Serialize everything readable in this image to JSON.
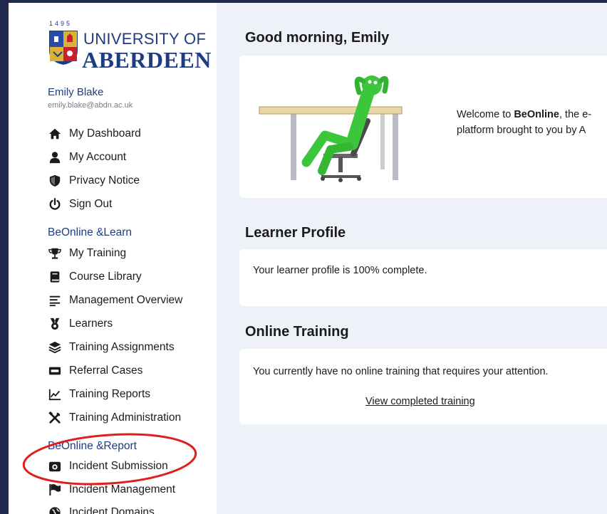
{
  "brand": {
    "year": "1495",
    "line1": "UNIVERSITY OF",
    "line2": "ABERDEEN",
    "color": "#1f3b82"
  },
  "user": {
    "name": "Emily Blake",
    "email": "emily.blake@abdn.ac.uk"
  },
  "nav_account": [
    {
      "label": "My Dashboard",
      "icon": "home-icon"
    },
    {
      "label": "My Account",
      "icon": "user-icon"
    },
    {
      "label": "Privacy Notice",
      "icon": "shield-icon"
    },
    {
      "label": "Sign Out",
      "icon": "power-icon"
    }
  ],
  "section_learn": {
    "title": "BeOnline &Learn",
    "items": [
      {
        "label": "My Training",
        "icon": "trophy-icon"
      },
      {
        "label": "Course Library",
        "icon": "book-icon"
      },
      {
        "label": "Management Overview",
        "icon": "bars-icon"
      },
      {
        "label": "Learners",
        "icon": "medal-icon"
      },
      {
        "label": "Training Assignments",
        "icon": "layers-icon"
      },
      {
        "label": "Referral Cases",
        "icon": "card-icon"
      },
      {
        "label": "Training Reports",
        "icon": "line-chart-icon"
      },
      {
        "label": "Training Administration",
        "icon": "tools-icon"
      }
    ]
  },
  "section_report": {
    "title": "BeOnline &Report",
    "items": [
      {
        "label": "Incident Submission",
        "icon": "camera-icon"
      },
      {
        "label": "Incident Management",
        "icon": "flag-icon"
      },
      {
        "label": "Incident Domains",
        "icon": "globe-icon"
      }
    ]
  },
  "main": {
    "greeting": "Good morning, Emily",
    "welcome_prefix": "Welcome to ",
    "welcome_brand": "BeOnline",
    "welcome_rest": ", the e-",
    "welcome_line2": "platform brought to you by A",
    "learner_profile_title": "Learner Profile",
    "learner_profile_text": "Your learner profile is 100% complete.",
    "online_training_title": "Online Training",
    "online_training_text": "You currently have no online training that requires your attention.",
    "view_completed_link": "View completed training"
  },
  "colors": {
    "accent": "#1f3b82",
    "background": "#eef1f8",
    "annotation": "#e01e1e",
    "mascot": "#3cc63c"
  }
}
